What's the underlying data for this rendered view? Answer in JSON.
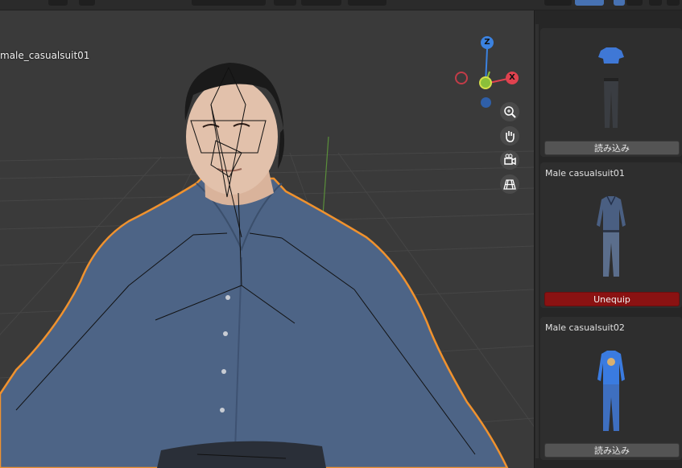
{
  "viewport": {
    "object_label": "male_casualsuit01",
    "gizmo": {
      "z": "Z",
      "y": "Y",
      "x": "X"
    }
  },
  "toolbar_icons": [
    "zoom-in-icon",
    "hand-pan-icon",
    "camera-icon",
    "grid-perspective-icon"
  ],
  "panel": {
    "cards": [
      {
        "title": "",
        "button": "読み込み",
        "state": "load"
      },
      {
        "title": "Male casualsuit01",
        "button": "Unequip",
        "state": "equipped"
      },
      {
        "title": "Male casualsuit02",
        "button": "読み込み",
        "state": "load"
      }
    ]
  },
  "colors": {
    "selection_outline": "#f0922e",
    "unequip": "#8a1212",
    "axis_x": "#e0424f",
    "axis_y": "#8bbf3a",
    "axis_z": "#3b82e0"
  }
}
